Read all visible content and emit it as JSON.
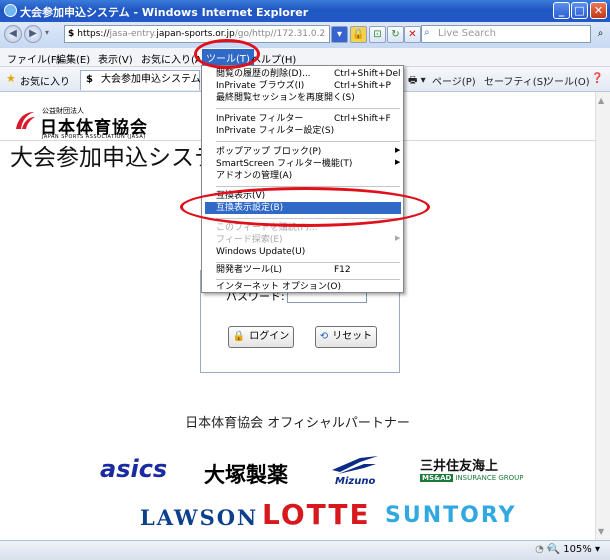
{
  "window": {
    "title": "大会参加申込システム - Windows Internet Explorer"
  },
  "address": {
    "scheme": "https://",
    "host_pre": "jasa-entry.",
    "host": "japan-sports.or.jp",
    "path": "/go/http//172.31.0.2"
  },
  "search": {
    "placeholder": "Live Search"
  },
  "menubar": {
    "items": [
      "ファイル(F)",
      "編集(E)",
      "表示(V)",
      "お気に入り(A)",
      "ツール(T)",
      "ヘルプ(H)"
    ]
  },
  "favbar": {
    "favorites": "お気に入り",
    "tab_title": "大会参加申込システム",
    "commands": [
      "ページ(P)",
      "セーフティ(S)",
      "ツール(O)"
    ]
  },
  "page": {
    "org_small": "公益財団法人",
    "org_name": "日本体育協会",
    "org_en": "JAPAN SPORTS ASSOCIATION (JASA)",
    "system_title": "大会参加申込システム",
    "password_label": "パスワード:",
    "login_button": "ログイン",
    "reset_button": "リセット",
    "partner_title": "日本体育協会 オフィシャルパートナー"
  },
  "sponsors": {
    "asics": "asics",
    "otsuka": "大塚製薬",
    "mizuno": "Mizuno",
    "mitsui": "三井住友海上",
    "ms_box": "MS&AD",
    "ms_rest": "INSURANCE GROUP",
    "lawson": "LAWSON",
    "lotte": "LOTTE",
    "suntory": "SUNTORY"
  },
  "tools_menu": {
    "items": [
      {
        "label": "閲覧の履歴の削除(D)...",
        "shortcut": "Ctrl+Shift+Del"
      },
      {
        "label": "InPrivate ブラウズ(I)",
        "shortcut": "Ctrl+Shift+P"
      },
      {
        "label": "最終閲覧セッションを再度開く(S)",
        "shortcut": ""
      },
      {
        "label": "InPrivate フィルター",
        "shortcut": "Ctrl+Shift+F"
      },
      {
        "label": "InPrivate フィルター設定(S)",
        "shortcut": ""
      },
      {
        "label": "ポップアップ ブロック(P)",
        "shortcut": ""
      },
      {
        "label": "SmartScreen フィルター機能(T)",
        "shortcut": ""
      },
      {
        "label": "アドオンの管理(A)",
        "shortcut": ""
      },
      {
        "label": "互換表示(V)",
        "shortcut": ""
      },
      {
        "label": "互換表示設定(B)",
        "shortcut": ""
      },
      {
        "label": "このフィードを購読(F)...",
        "shortcut": ""
      },
      {
        "label": "フィード探索(E)",
        "shortcut": ""
      },
      {
        "label": "Windows Update(U)",
        "shortcut": ""
      },
      {
        "label": "開発者ツール(L)",
        "shortcut": "F12"
      },
      {
        "label": "インターネット オプション(O)",
        "shortcut": ""
      }
    ]
  },
  "status": {
    "zoom": "105%"
  }
}
